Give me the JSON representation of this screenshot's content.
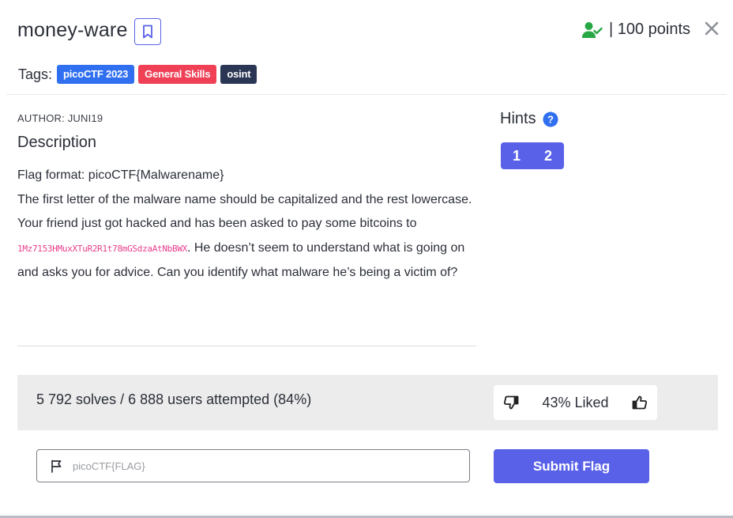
{
  "challenge": {
    "title": "money-ware",
    "points": "| 100 points"
  },
  "tags": {
    "label": "Tags:",
    "items": [
      "picoCTF 2023",
      "General Skills",
      "osint"
    ]
  },
  "author": "AUTHOR: JUNI19",
  "description": {
    "heading": "Description",
    "line1": "Flag format: picoCTF{Malwarename}",
    "line2": "The first letter of the malware name should be capitalized and the rest lowercase.",
    "line3_prefix": "Your friend just got hacked and has been asked to pay some bitcoins to ",
    "bitcoin_address": "1Mz7153HMuxXTuR2R1t78mGSdzaAtNbBWX",
    "line3_suffix": ". He doesn’t seem to understand what is going on and asks you for advice. Can you identify what malware he’s being a victim of?"
  },
  "hints": {
    "heading": "Hints",
    "buttons": [
      "1",
      "2"
    ]
  },
  "stats": {
    "solves_text": "5 792 solves / 6 888 users attempted (84%)",
    "liked_text": "43% Liked"
  },
  "flag_form": {
    "placeholder": "picoCTF{FLAG}",
    "value": "",
    "submit_label": "Submit Flag"
  },
  "icons": {
    "bookmark": "bookmark-icon",
    "user_check": "user-check-icon",
    "close": "close-icon",
    "help": "question-circle-icon",
    "thumbs_down": "thumbs-down-icon",
    "thumbs_up": "thumbs-up-icon",
    "flag": "flag-icon"
  },
  "colors": {
    "primary": "#5961e8",
    "solved_green": "#28a745",
    "tag_blue": "#2f6ff0",
    "tag_red": "#ef4055",
    "tag_dark": "#2b3654",
    "hint_help": "#2f6ff0",
    "code_pink": "#e83e8c"
  }
}
